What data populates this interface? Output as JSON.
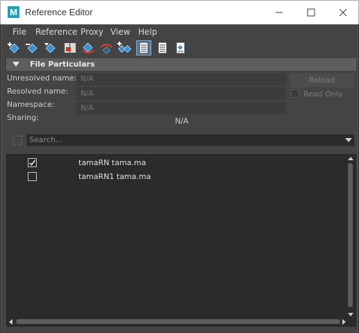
{
  "window": {
    "title": "Reference Editor",
    "app_icon_letter": "M"
  },
  "menu": [
    "File",
    "Reference",
    "Proxy",
    "View",
    "Help"
  ],
  "toolbar": {
    "tools": [
      {
        "name": "create-reference-icon"
      },
      {
        "name": "remove-reference-icon"
      },
      {
        "name": "import-objects-icon"
      },
      {
        "name": "load-related-icon"
      },
      {
        "name": "reload-reference-icon"
      },
      {
        "name": "unload-reference-icon"
      },
      {
        "name": "duplicate-reference-icon"
      },
      {
        "name": "list-view-icon",
        "active": true
      },
      {
        "name": "detail-view-icon"
      },
      {
        "name": "hierarchy-view-icon"
      }
    ]
  },
  "file_particulars": {
    "header": "File Particulars",
    "unresolved_label": "Unresolved name:",
    "unresolved_value": "N/A",
    "resolved_label": "Resolved name:",
    "resolved_value": "N/A",
    "namespace_label": "Namespace:",
    "namespace_value": "N/A",
    "sharing_label": "Sharing:",
    "sharing_value": "N/A",
    "reload_label": "Reload",
    "readonly_label": "Read Only"
  },
  "search": {
    "placeholder": "Search..."
  },
  "references": [
    {
      "checked": true,
      "label": "tamaRN tama.ma"
    },
    {
      "checked": false,
      "label": "tamaRN1 tama.ma"
    }
  ]
}
